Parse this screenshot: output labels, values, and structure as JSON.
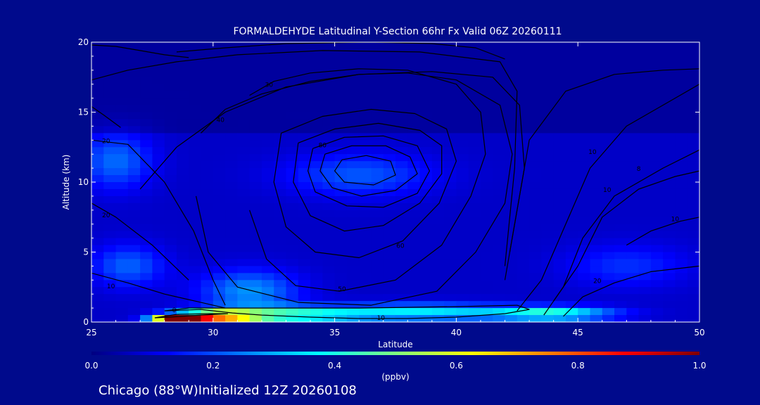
{
  "chart_data": {
    "type": "heatmap",
    "title": "FORMALDEHYDE Latitudinal Y-Section 66hr  Fx Valid 06Z 20260111",
    "xlabel": "Latitude",
    "ylabel": "Altitude (km)",
    "xlim": [
      25,
      50
    ],
    "ylim": [
      0,
      20
    ],
    "x_ticks": [
      25,
      30,
      35,
      40,
      45,
      50
    ],
    "y_ticks": [
      0,
      5,
      10,
      15,
      20
    ],
    "colorbar": {
      "label": "(ppbv)",
      "min": 0.0,
      "max": 1.0,
      "ticks": [
        "0.0",
        "0.2",
        "0.4",
        "0.6",
        "0.8",
        "1.0"
      ],
      "colormap": [
        "#000080",
        "#0000ff",
        "#0080ff",
        "#00ffff",
        "#80ff80",
        "#ffff00",
        "#ff8000",
        "#ff0000",
        "#800000"
      ]
    },
    "field_blobs": [
      {
        "lat": 28.6,
        "alt": 0.25,
        "value": 0.95,
        "sx": 1.0,
        "sy": 0.3
      },
      {
        "lat": 30.2,
        "alt": 0.4,
        "value": 0.55,
        "sx": 1.6,
        "sy": 0.45
      },
      {
        "lat": 33.0,
        "alt": 0.5,
        "value": 0.32,
        "sx": 3.0,
        "sy": 0.6
      },
      {
        "lat": 38.5,
        "alt": 0.7,
        "value": 0.28,
        "sx": 4.0,
        "sy": 0.6
      },
      {
        "lat": 44.0,
        "alt": 0.6,
        "value": 0.32,
        "sx": 2.5,
        "sy": 0.5
      },
      {
        "lat": 31.5,
        "alt": 2.2,
        "value": 0.2,
        "sx": 2.0,
        "sy": 1.5
      },
      {
        "lat": 26.0,
        "alt": 11.5,
        "value": 0.16,
        "sx": 1.5,
        "sy": 2.0
      },
      {
        "lat": 26.5,
        "alt": 4.0,
        "value": 0.15,
        "sx": 1.5,
        "sy": 1.5
      },
      {
        "lat": 36.0,
        "alt": 10.5,
        "value": 0.14,
        "sx": 3.0,
        "sy": 1.5
      },
      {
        "lat": 47.0,
        "alt": 4.0,
        "value": 0.1,
        "sx": 2.5,
        "sy": 1.5
      }
    ],
    "contours": [
      {
        "label": "10",
        "label_at": [
          36.9,
          0.15
        ],
        "lat": [
          28,
          29.5,
          30.8,
          32,
          34,
          36,
          38,
          40,
          42,
          43,
          42.5,
          40,
          36,
          32,
          29,
          28
        ],
        "alt": [
          0.8,
          0.9,
          0.65,
          0.5,
          0.35,
          0.25,
          0.25,
          0.35,
          0.6,
          0.9,
          1.2,
          1.1,
          1.0,
          1.0,
          1.0,
          0.8
        ]
      },
      {
        "label": "0",
        "label_at": [
          28.4,
          0.7
        ],
        "lat": [
          27.6,
          28.5,
          29.8,
          30.6,
          29.5,
          28.2,
          27.6
        ],
        "alt": [
          0.3,
          0.55,
          0.6,
          0.6,
          0.5,
          0.35,
          0.3
        ]
      },
      {
        "label": "50",
        "label_at": [
          35.3,
          2.2
        ],
        "lat": [
          31.5,
          32.5,
          34,
          36,
          38,
          40,
          41,
          41.2,
          40.6,
          39.4,
          37.5,
          35.2,
          33.4,
          32.2,
          31.5
        ],
        "alt": [
          16.2,
          17.2,
          17.8,
          18.1,
          18.0,
          17.0,
          15.0,
          12.0,
          9.0,
          5.5,
          3.0,
          2.2,
          2.6,
          4.5,
          8.0
        ]
      },
      {
        "label": "40",
        "label_at": [
          30.3,
          14.3
        ],
        "lat": [
          29.5,
          30.5,
          32,
          34,
          36,
          38,
          40,
          41.8,
          42.3,
          42.0,
          40.8,
          39.2,
          36.5,
          33.5,
          31.0,
          29.8,
          29.3
        ],
        "alt": [
          13.5,
          15.2,
          16.3,
          17.2,
          17.7,
          17.8,
          17.3,
          15.5,
          12.0,
          8.5,
          5.0,
          2.2,
          1.2,
          1.4,
          2.5,
          5.0,
          9.0
        ]
      },
      {
        "label": "30",
        "label_at": [
          32.3,
          16.8
        ],
        "lat": [
          27.0,
          28.5,
          30.5,
          33,
          36,
          39,
          41.5,
          42.6,
          42.8,
          42.2
        ],
        "alt": [
          9.5,
          12.5,
          15.0,
          16.8,
          17.7,
          17.9,
          17.5,
          15.5,
          11.0,
          5.0
        ]
      },
      {
        "label": "20",
        "label_at": [
          25.6,
          12.8
        ],
        "lat": [
          25,
          26.5,
          28.0,
          29.2,
          30.0,
          30.5
        ],
        "alt": [
          13.0,
          12.7,
          10.0,
          6.5,
          3.0,
          1.2
        ]
      },
      {
        "label": "60",
        "label_at": [
          37.7,
          5.3
        ],
        "lat": [
          32.8,
          34.5,
          36.5,
          38.3,
          39.6,
          40.0,
          39.3,
          37.8,
          36.0,
          34.2,
          33.0,
          32.5,
          32.8
        ],
        "alt": [
          13.5,
          14.7,
          15.2,
          14.9,
          13.8,
          11.5,
          8.5,
          5.8,
          4.6,
          5.0,
          6.8,
          10.0,
          13.5
        ]
      },
      {
        "label": "",
        "label_at": [
          0,
          0
        ],
        "lat": [
          33.5,
          35,
          36.8,
          38.5,
          39.4,
          39.4,
          38.5,
          37.0,
          35.4,
          34.0,
          33.3,
          33.5
        ],
        "alt": [
          12.8,
          13.8,
          14.2,
          13.7,
          12.6,
          10.6,
          8.5,
          6.9,
          6.5,
          7.6,
          10.0,
          12.8
        ]
      },
      {
        "label": "",
        "label_at": [
          0,
          0
        ],
        "lat": [
          34.1,
          35.4,
          37.0,
          38.4,
          38.9,
          38.4,
          37.0,
          35.5,
          34.2,
          33.9,
          34.1
        ],
        "alt": [
          12.4,
          13.2,
          13.3,
          12.6,
          10.8,
          9.2,
          8.2,
          8.3,
          9.3,
          10.8,
          12.4
        ]
      },
      {
        "label": "80",
        "label_at": [
          34.5,
          12.5
        ],
        "lat": [
          34.6,
          35.7,
          37.1,
          38.1,
          38.4,
          37.5,
          36.1,
          34.9,
          34.4,
          34.6
        ],
        "alt": [
          12.0,
          12.6,
          12.6,
          11.8,
          10.6,
          9.4,
          9.0,
          9.6,
          10.8,
          12.0
        ]
      },
      {
        "label": "",
        "label_at": [
          0,
          0
        ],
        "lat": [
          35.3,
          36.3,
          37.3,
          37.5,
          36.6,
          35.4,
          35.0,
          35.3
        ],
        "alt": [
          11.6,
          11.9,
          11.5,
          10.5,
          9.8,
          10.0,
          10.8,
          11.6
        ]
      },
      {
        "label": "10",
        "label_at": [
          45.6,
          12.0
        ],
        "lat": [
          42.5,
          43.5,
          44.5,
          45.5,
          47,
          49,
          50
        ],
        "alt": [
          0.8,
          3.0,
          7.0,
          11.0,
          14.0,
          16.0,
          17.0
        ]
      },
      {
        "label": "8",
        "label_at": [
          47.5,
          10.8
        ],
        "lat": [
          43.6,
          44.4,
          45.2,
          46.5,
          48.5,
          50
        ],
        "alt": [
          0.5,
          2.5,
          6.0,
          9.0,
          11.0,
          12.3
        ]
      },
      {
        "label": "10",
        "label_at": [
          46.2,
          9.3
        ],
        "lat": [
          44.0,
          45.0,
          46.0,
          47.5,
          49,
          50
        ],
        "alt": [
          1.5,
          4.0,
          7.5,
          9.5,
          10.4,
          10.8
        ]
      },
      {
        "label": "",
        "label_at": [
          0,
          0
        ],
        "lat": [
          42.0,
          42.5,
          43.0,
          44.5,
          46.5,
          48.5,
          50
        ],
        "alt": [
          3.0,
          8.0,
          13.0,
          16.5,
          17.7,
          18.0,
          18.1
        ]
      },
      {
        "label": "",
        "label_at": [
          0,
          0
        ],
        "lat": [
          28.5,
          30.5,
          33.0,
          36.5,
          39.0,
          40.8,
          42.0
        ],
        "alt": [
          19.3,
          19.6,
          19.9,
          20.0,
          19.9,
          19.6,
          18.8
        ]
      },
      {
        "label": "",
        "label_at": [
          0,
          0
        ],
        "lat": [
          25,
          26.5,
          28.5,
          31.0,
          34.5,
          38.5,
          41.8,
          42.5,
          42.4,
          42.0
        ],
        "alt": [
          17.3,
          18.0,
          18.6,
          19.1,
          19.4,
          19.3,
          18.6,
          16.5,
          11.0,
          4.0
        ]
      },
      {
        "label": "20",
        "label_at": [
          45.8,
          2.8
        ],
        "lat": [
          44.4,
          45.2,
          46.5,
          48.0,
          49.5,
          50
        ],
        "alt": [
          0.4,
          1.8,
          2.8,
          3.6,
          3.9,
          4.0
        ]
      },
      {
        "label": "10",
        "label_at": [
          49.0,
          7.2
        ],
        "lat": [
          47.0,
          48.0,
          49.2,
          50
        ],
        "alt": [
          5.5,
          6.5,
          7.2,
          7.5
        ]
      },
      {
        "label": "",
        "label_at": [
          0,
          0
        ],
        "lat": [
          25,
          26.0,
          27.0,
          28.0,
          29.0
        ],
        "alt": [
          19.8,
          19.7,
          19.4,
          19.1,
          18.9
        ]
      },
      {
        "label": "10",
        "label_at": [
          25.8,
          2.4
        ],
        "lat": [
          25,
          26.5,
          28.0,
          29.5,
          30.5
        ],
        "alt": [
          3.5,
          2.8,
          2.0,
          1.4,
          1.0
        ]
      },
      {
        "label": "20",
        "label_at": [
          25.6,
          7.5
        ],
        "lat": [
          25,
          26.0,
          27.5,
          29.0
        ],
        "alt": [
          8.5,
          7.5,
          5.5,
          3.0
        ]
      },
      {
        "label": "",
        "label_at": [
          0,
          0
        ],
        "lat": [
          25,
          25.5,
          26.2
        ],
        "alt": [
          15.4,
          14.8,
          13.9
        ]
      }
    ]
  },
  "footer": {
    "text": "Chicago (88°W)Initialized 12Z 20260108"
  }
}
